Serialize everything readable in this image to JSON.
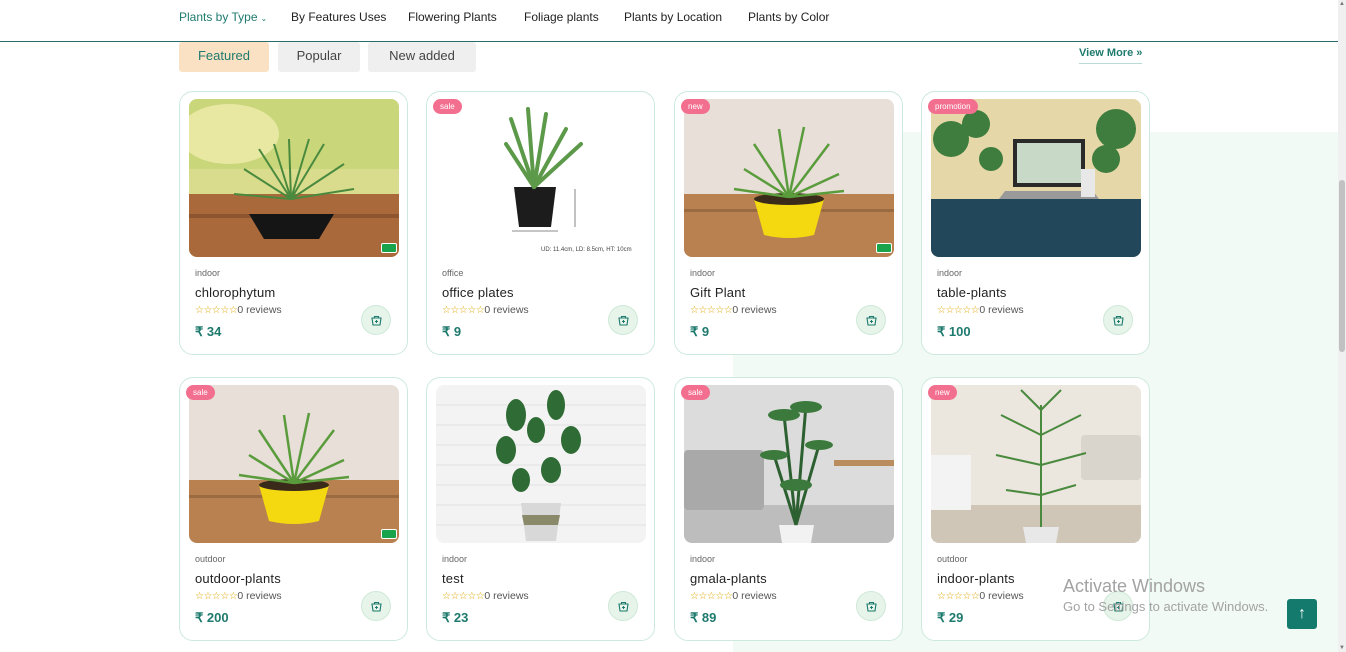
{
  "nav": {
    "items": [
      {
        "label": "Plants by Type",
        "active": true,
        "has_dropdown": true
      },
      {
        "label": "By Features Uses"
      },
      {
        "label": "Flowering Plants"
      },
      {
        "label": "Foliage plants"
      },
      {
        "label": "Plants by Location"
      },
      {
        "label": "Plants by Color"
      }
    ]
  },
  "tabs": [
    {
      "label": "Featured",
      "active": true
    },
    {
      "label": "Popular"
    },
    {
      "label": "New added"
    }
  ],
  "view_more": {
    "label": "View More",
    "icon": "double-chevron-right-icon"
  },
  "currency": "₹",
  "products": [
    {
      "category": "indoor",
      "name": "chlorophytum",
      "reviews": "0 reviews",
      "price": "₹ 34",
      "badge": "",
      "eco": true
    },
    {
      "category": "office",
      "name": "office plates",
      "reviews": "0 reviews",
      "price": "₹ 9",
      "badge": "sale",
      "eco": false,
      "image_caption": "UD: 11.4cm, LD: 8.5cm, HT: 10cm"
    },
    {
      "category": "indoor",
      "name": "Gift Plant",
      "reviews": "0 reviews",
      "price": "₹ 9",
      "badge": "new",
      "eco": true
    },
    {
      "category": "indoor",
      "name": "table-plants",
      "reviews": "0 reviews",
      "price": "₹ 100",
      "badge": "promotion",
      "eco": false
    },
    {
      "category": "outdoor",
      "name": "outdoor-plants",
      "reviews": "0 reviews",
      "price": "₹ 200",
      "badge": "sale",
      "eco": true
    },
    {
      "category": "indoor",
      "name": "test",
      "reviews": "0 reviews",
      "price": "₹ 23",
      "badge": "",
      "eco": false
    },
    {
      "category": "indoor",
      "name": "gmala-plants",
      "reviews": "0 reviews",
      "price": "₹ 89",
      "badge": "sale",
      "eco": false
    },
    {
      "category": "outdoor",
      "name": "indoor-plants",
      "reviews": "0 reviews",
      "price": "₹ 29",
      "badge": "new",
      "eco": false
    }
  ],
  "rating_stars": "☆☆☆☆☆",
  "watermark": {
    "line1": "Activate Windows",
    "line2": "Go to Settings to activate Windows."
  },
  "scroll_top": {
    "icon": "arrow-up-icon",
    "glyph": "↑"
  },
  "colors": {
    "accent": "#1f7a6e",
    "badge": "#f36f8f",
    "featured_tab": "#fbe1c3",
    "star": "#e0a400"
  }
}
